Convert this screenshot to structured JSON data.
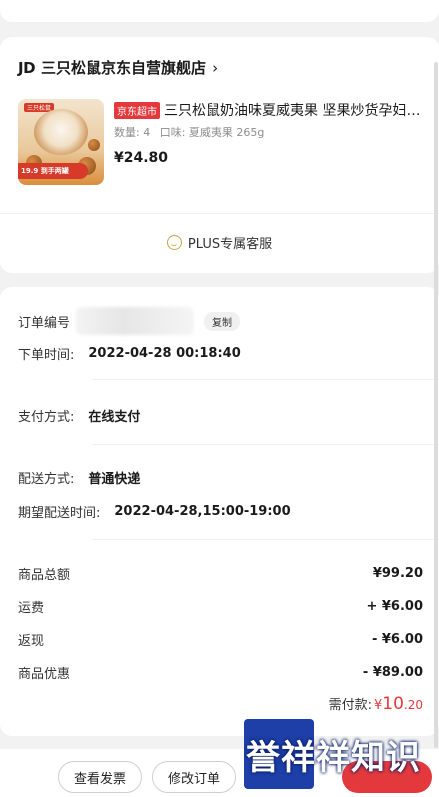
{
  "shop": {
    "logo_text": "JD",
    "name": "三只松鼠京东自营旗舰店",
    "chevron": "›"
  },
  "product": {
    "badge": "京东超市",
    "title": "三只松鼠奶油味夏威夷果 坚果炒货孕妇…",
    "qty": "数量: 4",
    "flavor": "口味: 夏威夷果 265g",
    "price": "¥24.80",
    "thumb_promo": "19.9 到手两罐",
    "thumb_tag": "三只松鼠"
  },
  "plus_service": {
    "label": "PLUS专属客服",
    "icon": "smile-service-icon"
  },
  "order_info": {
    "order_no_label": "订单编号",
    "copy_label": "复制",
    "order_time_label": "下单时间:",
    "order_time": "2022-04-28 00:18:40",
    "pay_label": "支付方式:",
    "pay_value": "在线支付",
    "ship_label": "配送方式:",
    "ship_value": "普通快递",
    "eta_label": "期望配送时间:",
    "eta_value": "2022-04-28,15:00-19:00"
  },
  "amounts": {
    "goods_total_label": "商品总额",
    "goods_total": "¥99.20",
    "freight_label": "运费",
    "freight": "+ ¥6.00",
    "cashback_label": "返现",
    "cashback": "- ¥6.00",
    "discount_label": "商品优惠",
    "discount": "- ¥89.00",
    "payable_label": "需付款:",
    "payable_currency": "¥",
    "payable_int": "10",
    "payable_dec": ".20"
  },
  "bottom_bar": {
    "invoice_button": "查看发票",
    "modify_button": "修改订单"
  },
  "watermark": {
    "text": "誉祥祥知识"
  },
  "colors": {
    "accent_red": "#e4393c",
    "watermark_blue": "#1e3fa8",
    "plus_gold": "#c9a44e"
  }
}
